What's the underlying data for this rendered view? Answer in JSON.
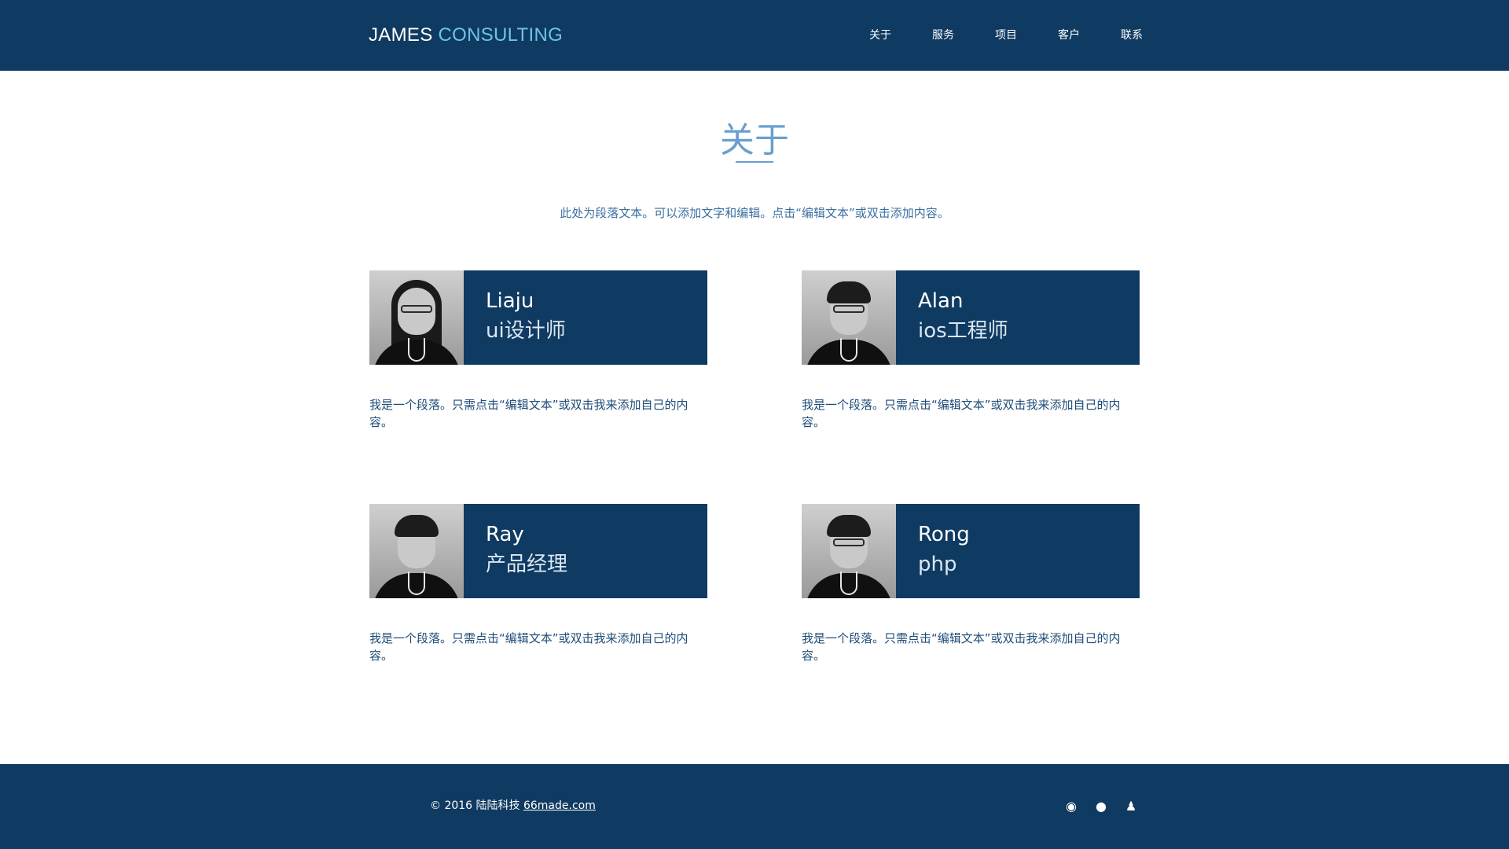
{
  "header": {
    "logo_part1": "JAMES",
    "logo_part2": "CONSULTING",
    "nav": [
      "关于",
      "服务",
      "项目",
      "客户",
      "联系"
    ]
  },
  "section": {
    "title": "关于",
    "intro": "此处为段落文本。可以添加文字和编辑。点击“编辑文本”或双击添加内容。"
  },
  "team": [
    {
      "name": "Liaju",
      "role": "ui设计师",
      "photo": "portrait-woman-glasses",
      "desc": "我是一个段落。只需点击“编辑文本”或双击我来添加自己的内容。"
    },
    {
      "name": "Alan",
      "role": "ios工程师",
      "photo": "portrait-man-glasses",
      "desc": "我是一个段落。只需点击“编辑文本”或双击我来添加自己的内容。"
    },
    {
      "name": "Ray",
      "role": "产品经理",
      "photo": "portrait-man",
      "desc": "我是一个段落。只需点击“编辑文本”或双击我来添加自己的内容。"
    },
    {
      "name": "Rong",
      "role": "php",
      "photo": "portrait-man-glasses",
      "desc": "我是一个段落。只需点击“编辑文本”或双击我来添加自己的内容。"
    }
  ],
  "footer": {
    "copyright": "© 2016 陆陆科技",
    "link": "66made.com",
    "social_icons": [
      "weibo-icon",
      "wechat-icon",
      "qq-icon"
    ]
  },
  "colors": {
    "primary": "#0f3a61",
    "accent": "#6fc3e8",
    "title": "#6a9fcf"
  }
}
